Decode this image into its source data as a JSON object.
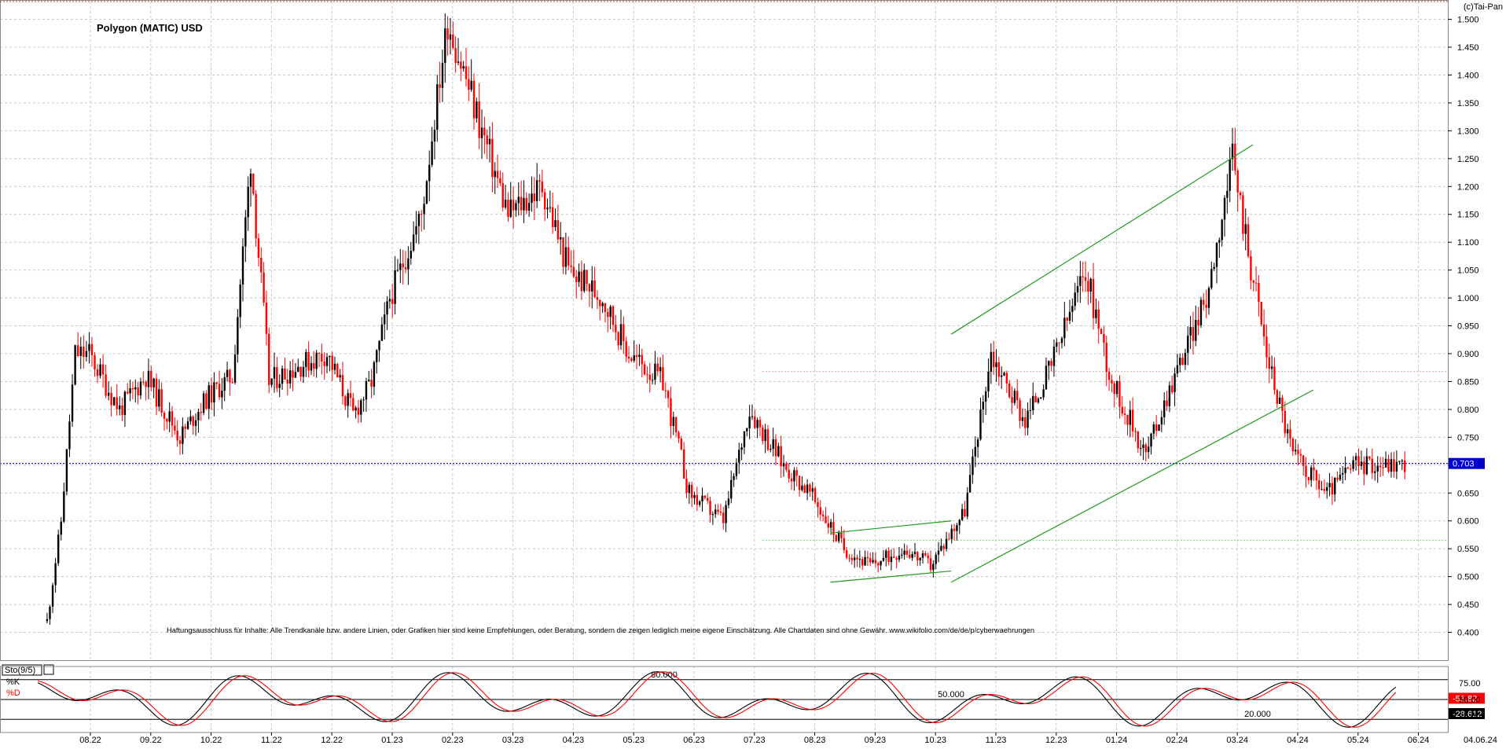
{
  "title": "Polygon (MATIC) USD",
  "copyright": "(c)Tai-Pan",
  "disclaimer": "Haftungsausschluss für Inhalte: Alle Trendkanäle bzw. andere Linien, oder Grafiken hier sind keine Empfehlungen, oder Beratung, sondern die zeigen lediglich meine eigene Einschätzung. Alle Chartdaten sind ohne Gewähr. www.wikifolio.com/de/de/p/cyberwaehrungen",
  "colors": {
    "up": "#000000",
    "down": "#ff0000",
    "trendline": "#1f9a1f",
    "current_price_line": "#0000cc",
    "current_price_badge": "#0000cc",
    "resistance_line": "#e8a0a0",
    "support_line": "#7fe07f",
    "stoch_k": "#000000",
    "stoch_d": "#ff0000",
    "stoch_d_badge": "#ff0000",
    "stoch_k_badge": "#000000",
    "grid": "#c8c8c8"
  },
  "chart_data": {
    "type": "candlestick",
    "ylim": [
      0.35,
      1.52
    ],
    "y_ticks": [
      "1.500",
      "1.450",
      "1.400",
      "1.350",
      "1.300",
      "1.250",
      "1.200",
      "1.150",
      "1.100",
      "1.050",
      "1.000",
      "0.950",
      "0.900",
      "0.850",
      "0.800",
      "0.750",
      "0.700",
      "0.650",
      "0.600",
      "0.550",
      "0.500",
      "0.450",
      "0.400"
    ],
    "x_ticks": [
      "08.22",
      "09.22",
      "10.22",
      "11.22",
      "12.22",
      "01.23",
      "02.23",
      "03.23",
      "04.23",
      "05.23",
      "06.23",
      "07.23",
      "08.23",
      "09.23",
      "10.23",
      "11.23",
      "12.23",
      "01.24",
      "02.24",
      "03.24",
      "04.24",
      "05.24",
      "06.24"
    ],
    "x_end_label": "04.06.24",
    "current_price": 0.703,
    "current_price_label": "0.703",
    "horizontal_levels": [
      {
        "value": 0.868,
        "kind": "resistance"
      },
      {
        "value": 0.565,
        "kind": "support"
      }
    ],
    "trendlines": [
      {
        "from": [
          "08.23",
          0.578
        ],
        "to": [
          "10.23",
          0.6
        ]
      },
      {
        "from": [
          "08.23",
          0.49
        ],
        "to": [
          "10.23",
          0.51
        ]
      },
      {
        "from": [
          "10.23",
          0.935
        ],
        "to": [
          "03.24",
          1.275
        ]
      },
      {
        "from": [
          "10.23",
          0.49
        ],
        "to": [
          "04.24",
          0.835
        ]
      }
    ],
    "price_path": [
      [
        "08.22",
        0.42
      ],
      [
        "08.22",
        0.6
      ],
      [
        "08.22",
        0.9
      ],
      [
        "08.22",
        0.9
      ],
      [
        "09.22",
        0.8
      ],
      [
        "09.22",
        0.86
      ],
      [
        "10.22",
        0.75
      ],
      [
        "10.22",
        0.82
      ],
      [
        "11.22",
        0.86
      ],
      [
        "11.22",
        1.25
      ],
      [
        "11.22",
        0.85
      ],
      [
        "12.22",
        0.88
      ],
      [
        "12.22",
        0.9
      ],
      [
        "01.23",
        0.79
      ],
      [
        "01.23",
        0.85
      ],
      [
        "01.23",
        1.0
      ],
      [
        "02.23",
        1.15
      ],
      [
        "02.23",
        1.5
      ],
      [
        "03.23",
        1.3
      ],
      [
        "03.23",
        1.15
      ],
      [
        "04.23",
        1.2
      ],
      [
        "04.23",
        1.05
      ],
      [
        "05.23",
        1.0
      ],
      [
        "05.23",
        0.9
      ],
      [
        "06.23",
        0.85
      ],
      [
        "06.23",
        0.65
      ],
      [
        "07.23",
        0.6
      ],
      [
        "07.23",
        0.8
      ],
      [
        "08.23",
        0.7
      ],
      [
        "08.23",
        0.65
      ],
      [
        "09.23",
        0.55
      ],
      [
        "09.23",
        0.52
      ],
      [
        "10.23",
        0.55
      ],
      [
        "10.23",
        0.52
      ],
      [
        "11.23",
        0.62
      ],
      [
        "11.23",
        0.9
      ],
      [
        "12.23",
        0.78
      ],
      [
        "12.23",
        0.88
      ],
      [
        "01.24",
        1.05
      ],
      [
        "01.24",
        0.85
      ],
      [
        "02.24",
        0.72
      ],
      [
        "02.24",
        0.85
      ],
      [
        "03.24",
        1.0
      ],
      [
        "03.24",
        1.25
      ],
      [
        "04.24",
        0.9
      ],
      [
        "04.24",
        0.72
      ],
      [
        "05.24",
        0.65
      ],
      [
        "05.24",
        0.7
      ],
      [
        "06.24",
        0.703
      ]
    ],
    "stochastic": {
      "label": "Sto(9/5)",
      "k_label": "%K",
      "d_label": "%D",
      "ylim": [
        0,
        100
      ],
      "levels": [
        {
          "value": 80,
          "label": "80.000"
        },
        {
          "value": 50,
          "label": "50.000"
        },
        {
          "value": 20,
          "label": "20.000"
        }
      ],
      "k_last": "28.612",
      "d_last": "51.82"
    }
  }
}
